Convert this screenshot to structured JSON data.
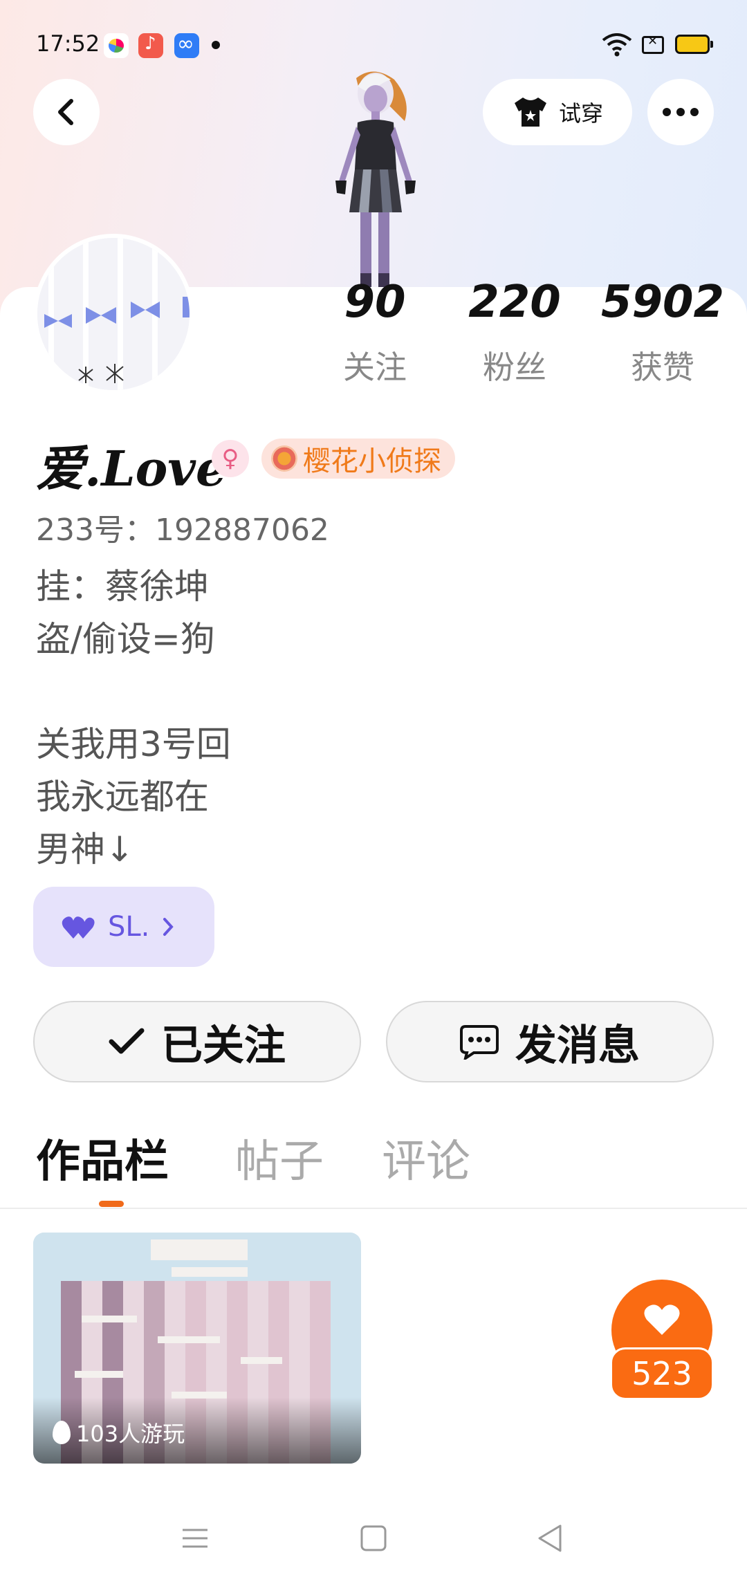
{
  "status_bar": {
    "time": "17:52"
  },
  "header": {
    "try_on_label": "试穿"
  },
  "profile": {
    "nickname": "爱.Love",
    "gender_symbol": "♀",
    "title_badge": "樱花小侦探",
    "uid": "233号：192887062",
    "bio": "挂：蔡徐坤\n盗/偷设=狗\n\n关我用3号回\n我永远都在\n男神↓",
    "tag_chip": "SL."
  },
  "stats": [
    {
      "value": "90",
      "label": "关注"
    },
    {
      "value": "220",
      "label": "粉丝"
    },
    {
      "value": "5902",
      "label": "获赞"
    }
  ],
  "actions": {
    "follow_label": "已关注",
    "message_label": "发消息"
  },
  "tabs": [
    {
      "label": "作品栏"
    },
    {
      "label": "帖子"
    },
    {
      "label": "评论"
    }
  ],
  "works": [
    {
      "plays": "103人游玩"
    }
  ],
  "floating": {
    "like_count": "523"
  },
  "colors": {
    "accent": "#fa6b12",
    "chip": "#e6e2fb",
    "chip_text": "#6656e0",
    "badge_text": "#f07a1a"
  }
}
